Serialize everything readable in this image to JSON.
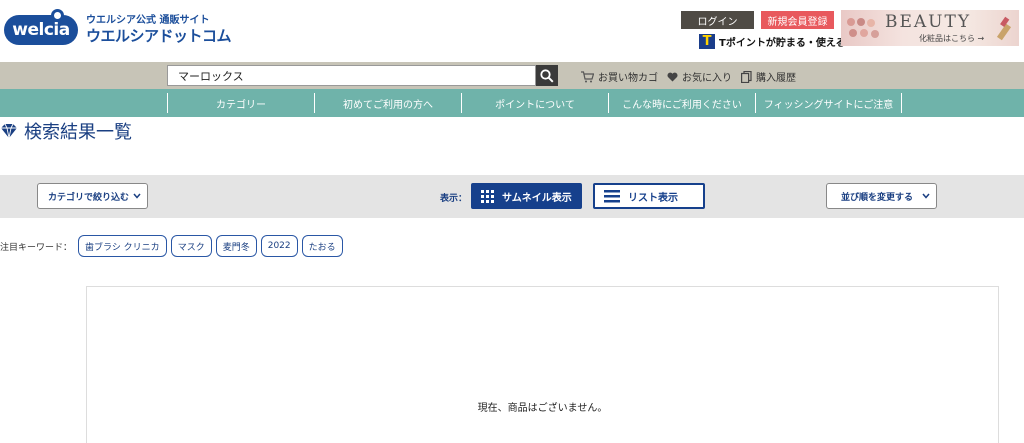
{
  "header": {
    "logo_word": "welcia",
    "logo_sub": "ウエルシア公式 通販サイト",
    "logo_main": "ウエルシアドットコム",
    "login_label": "ログイン",
    "register_label": "新規会員登録",
    "tpoint_mark": "T",
    "tpoint_label": "Tポイントが貯まる・使える",
    "banner_title": "BEAUTY",
    "banner_sub": "化粧品はこちら →"
  },
  "search": {
    "value": "マーロックス",
    "cart_label": "お買い物カゴ",
    "favorites_label": "お気に入り",
    "history_label": "購入履歴"
  },
  "nav": {
    "items": [
      {
        "label": "カテゴリー"
      },
      {
        "label": "初めてご利用の方へ"
      },
      {
        "label": "ポイントについて"
      },
      {
        "label": "こんな時にご利用ください"
      },
      {
        "label": "フィッシングサイトにご注意"
      }
    ]
  },
  "page": {
    "title": "検索結果一覧"
  },
  "toolbar": {
    "category_filter": "カテゴリで絞り込む",
    "display_label": "表示：",
    "thumbnail_label": "サムネイル表示",
    "list_label": "リスト表示",
    "sort_label": "並び順を変更する"
  },
  "keywords": {
    "label": "注目キーワード：",
    "tags": [
      "歯ブラシ クリニカ",
      "マスク",
      "麦門冬",
      "2022",
      "たおる"
    ]
  },
  "results": {
    "empty_message": "現在、商品はございません。"
  },
  "colors": {
    "brand_blue": "#1b4e9b",
    "nav_teal": "#6fb3aa",
    "search_bar": "#c7c4b7",
    "register_red": "#e8595d",
    "login_dark": "#4f4b45"
  }
}
